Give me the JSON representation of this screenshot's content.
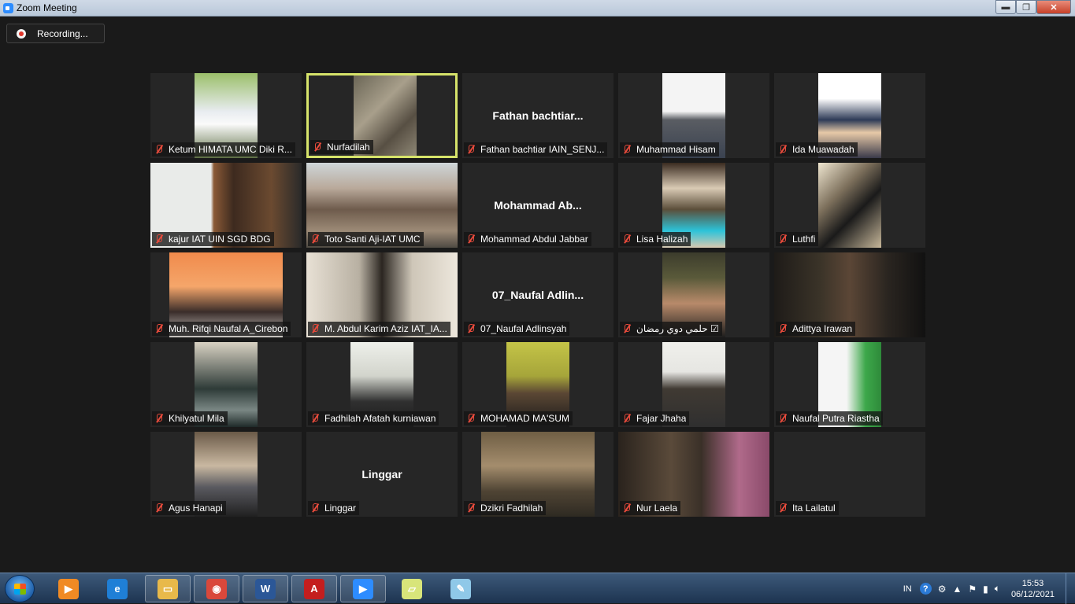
{
  "window": {
    "title": "Zoom Meeting",
    "minimize": "▬",
    "maximize": "❐",
    "close": "✕"
  },
  "recording": {
    "label": "Recording..."
  },
  "tiles": [
    {
      "name": "Ketum HIMATA UMC Diki R..."
    },
    {
      "name": "Nurfadilah",
      "active": true
    },
    {
      "name": "Fathan bachtiar IAIN_SENJ...",
      "display": "Fathan  bachtiar..."
    },
    {
      "name": "Muhammad Hisam"
    },
    {
      "name": "Ida Muawadah"
    },
    {
      "name": "kajur IAT UIN SGD BDG"
    },
    {
      "name": "Toto Santi Aji-IAT UMC"
    },
    {
      "name": "Mohammad Abdul Jabbar",
      "display": "Mohammad  Ab..."
    },
    {
      "name": "Lisa Halizah"
    },
    {
      "name": "Luthfi"
    },
    {
      "name": "Muh. Rifqi Naufal A_Cirebon"
    },
    {
      "name": "M. Abdul Karim Aziz IAT_IA..."
    },
    {
      "name": "07_Naufal Adlinsyah",
      "display": "07_Naufal  Adlin..."
    },
    {
      "name": "حلمي دوي رمضان ☑"
    },
    {
      "name": "Adittya Irawan"
    },
    {
      "name": "Khilyatul Mila"
    },
    {
      "name": "Fadhilah Afatah kurniawan"
    },
    {
      "name": "MOHAMAD MA'SUM"
    },
    {
      "name": "Fajar Jhaha"
    },
    {
      "name": "Naufal Putra Riastha"
    },
    {
      "name": "Agus Hanapi"
    },
    {
      "name": "Linggar",
      "display": "Linggar"
    },
    {
      "name": "Dzikri Fadhilah"
    },
    {
      "name": "Nur Laela"
    },
    {
      "name": "Ita Lailatul"
    }
  ],
  "taskbar": {
    "apps": [
      {
        "icon": "media-player-icon",
        "glyph": "▶",
        "color": "#f08a24"
      },
      {
        "icon": "internet-explorer-icon",
        "glyph": "e",
        "color": "#1f7fd6"
      },
      {
        "icon": "file-explorer-icon",
        "glyph": "▭",
        "color": "#e8b94a"
      },
      {
        "icon": "chrome-icon",
        "glyph": "◉",
        "color": "#d9483b"
      },
      {
        "icon": "word-icon",
        "glyph": "W",
        "color": "#2b5797"
      },
      {
        "icon": "acrobat-icon",
        "glyph": "A",
        "color": "#c41e1e"
      },
      {
        "icon": "zoom-icon",
        "glyph": "▶",
        "color": "#2d8cff"
      },
      {
        "icon": "sticky-notes-icon",
        "glyph": "▱",
        "color": "#d8e57a"
      },
      {
        "icon": "notepad-icon",
        "glyph": "✎",
        "color": "#8fc8e8"
      }
    ],
    "lang": "IN",
    "time": "15:53",
    "date": "06/12/2021"
  }
}
